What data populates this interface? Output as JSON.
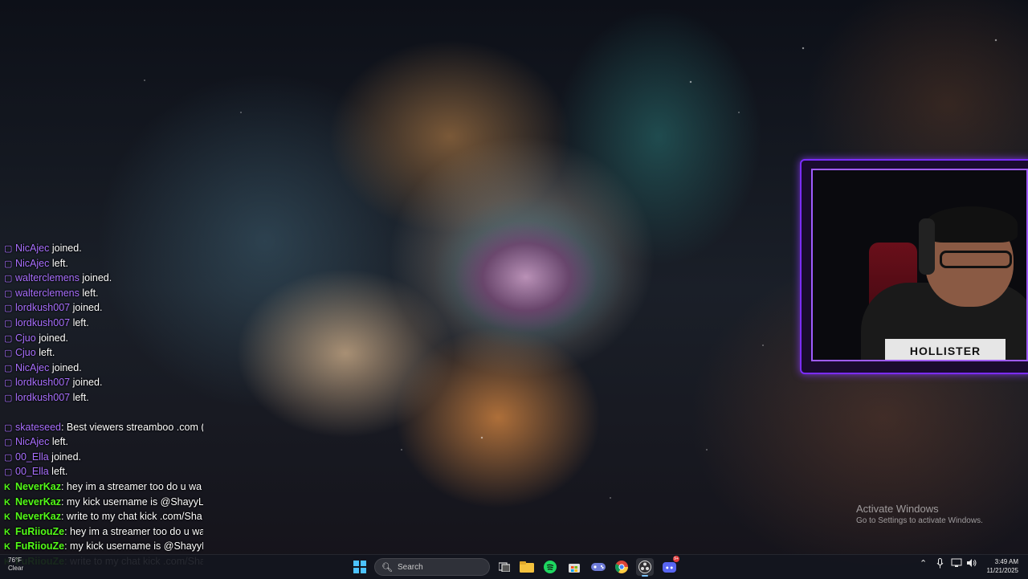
{
  "chat": {
    "lines": [
      {
        "platform": "twitch",
        "user": "NicAjec",
        "text": " joined."
      },
      {
        "platform": "twitch",
        "user": "NicAjec",
        "text": " left."
      },
      {
        "platform": "twitch",
        "user": "walterclemens",
        "text": " joined."
      },
      {
        "platform": "twitch",
        "user": "walterclemens",
        "text": " left."
      },
      {
        "platform": "twitch",
        "user": "lordkush007",
        "text": " joined."
      },
      {
        "platform": "twitch",
        "user": "lordkush007",
        "text": " left."
      },
      {
        "platform": "twitch",
        "user": "Cjuo",
        "text": " joined."
      },
      {
        "platform": "twitch",
        "user": "Cjuo",
        "text": " left."
      },
      {
        "platform": "twitch",
        "user": "NicAjec",
        "text": " joined."
      },
      {
        "platform": "twitch",
        "user": "lordkush007",
        "text": " joined."
      },
      {
        "platform": "twitch",
        "user": "lordkush007",
        "text": " left."
      }
    ],
    "lines2": [
      {
        "platform": "twitch",
        "user": "skateseed",
        "text": ": Best viewers streamboo .com ("
      },
      {
        "platform": "twitch",
        "user": "NicAjec",
        "text": " left."
      },
      {
        "platform": "twitch",
        "user": "00_Ella",
        "text": " joined."
      },
      {
        "platform": "twitch",
        "user": "00_Ella",
        "text": " left."
      },
      {
        "platform": "kick",
        "user": "NeverKaz",
        "text": ": hey im a streamer too do u wa"
      },
      {
        "platform": "kick",
        "user": "NeverKaz",
        "text": ": my kick username is @ShayyLo"
      },
      {
        "platform": "kick",
        "user": "NeverKaz",
        "text": ": write to my chat kick .com/Sha"
      },
      {
        "platform": "kick",
        "user": "FuRiiouZe",
        "text": ": hey im a streamer too do u wa"
      },
      {
        "platform": "kick",
        "user": "FuRiiouZe",
        "text": ": my kick username is @ShayyLo"
      },
      {
        "platform": "kick",
        "user": "FuRiiouZe",
        "text": ": write to my chat kick .com/Sha"
      }
    ],
    "icons": {
      "twitch": "twitch-chat-icon",
      "kick": "kick-chat-icon"
    },
    "colors": {
      "twitch": "#a970ff",
      "kick": "#53fc18"
    }
  },
  "webcam": {
    "shirt_text": "HOLLISTER",
    "frame_color": "#7b2cff"
  },
  "watermark": {
    "title": "Activate Windows",
    "subtitle": "Go to Settings to activate Windows."
  },
  "taskbar": {
    "weather_temp": "76°F",
    "weather_label": "Clear",
    "search_placeholder": "Search",
    "apps": [
      "start-icon",
      "task-view-icon",
      "file-explorer-icon",
      "spotify-icon",
      "microsoft-store-icon",
      "game-controller-icon",
      "chrome-icon",
      "obs-icon",
      "discord-icon"
    ],
    "discord_badge": "9+",
    "time": "3:49 AM",
    "date": "11/21/2025"
  }
}
